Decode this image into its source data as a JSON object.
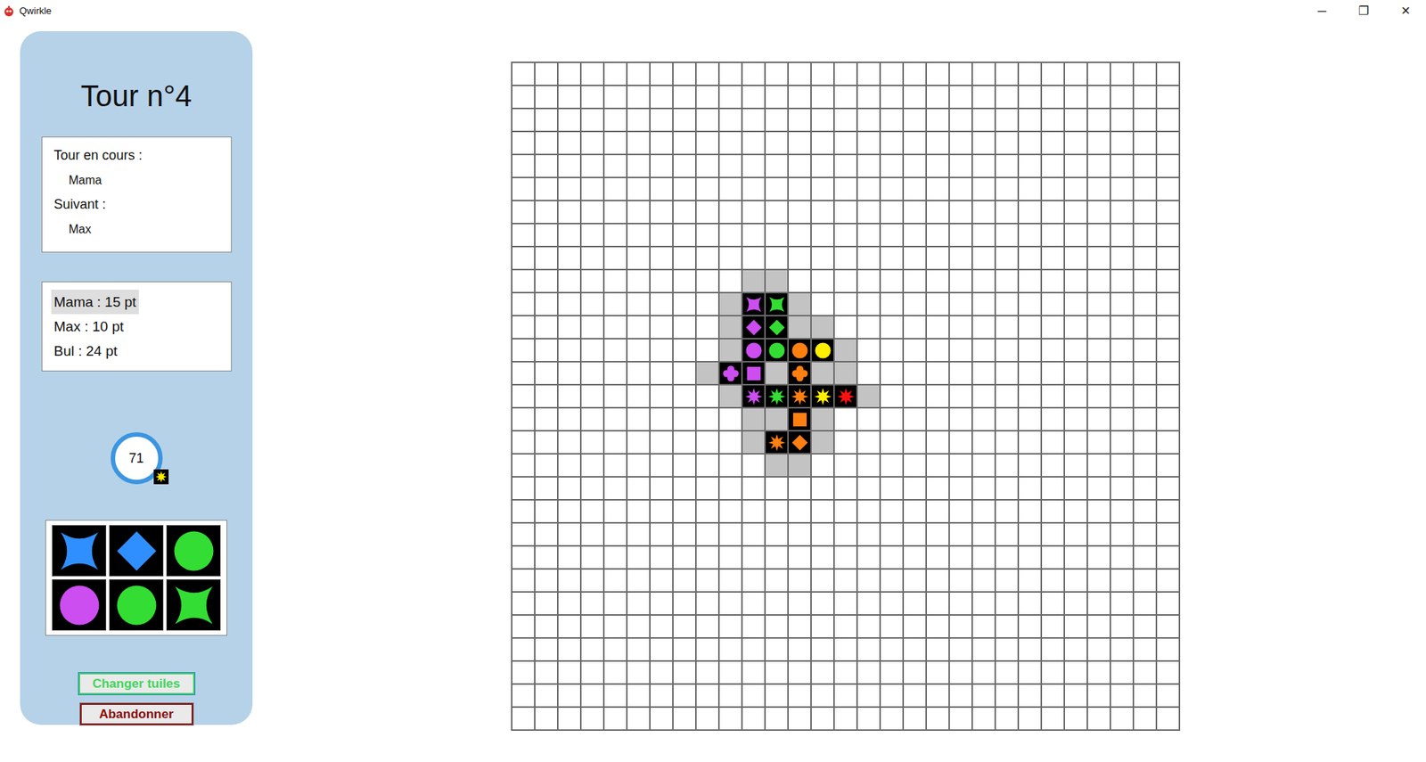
{
  "window": {
    "title": "Qwirkle",
    "controls": [
      "─",
      "❐",
      "✕"
    ]
  },
  "turn": {
    "title": "Tour n°4"
  },
  "current": {
    "label": "Tour en cours :",
    "player": "Mama",
    "next_label": "Suivant :",
    "next_player": "Max"
  },
  "scores": [
    {
      "text": "Mama : 15 pt",
      "selected": true
    },
    {
      "text": "Max : 10 pt",
      "selected": false
    },
    {
      "text": "Bul : 24 pt",
      "selected": false
    }
  ],
  "bag": {
    "count": "71"
  },
  "hand": [
    {
      "kind": "cross",
      "color": "#2f8fff"
    },
    {
      "kind": "diamond",
      "color": "#2f8fff"
    },
    {
      "kind": "circle",
      "color": "#33dd33"
    },
    {
      "kind": "circle",
      "color": "#cc4ef0"
    },
    {
      "kind": "circle",
      "color": "#33dd33"
    },
    {
      "kind": "cross",
      "color": "#33dd33"
    }
  ],
  "buttons": [
    {
      "label": "Changer tuiles",
      "kind": "exchange"
    },
    {
      "label": "Abandonner",
      "kind": "quit"
    }
  ],
  "board": {
    "size": 29,
    "tiles": [
      {
        "row": 10,
        "col": 10,
        "kind": "cross",
        "color": "#cc4ef0"
      },
      {
        "row": 10,
        "col": 11,
        "kind": "cross",
        "color": "#33dd33"
      },
      {
        "row": 11,
        "col": 10,
        "kind": "diamond",
        "color": "#cc4ef0"
      },
      {
        "row": 11,
        "col": 11,
        "kind": "diamond",
        "color": "#33dd33"
      },
      {
        "row": 12,
        "col": 10,
        "kind": "circle",
        "color": "#cc4ef0"
      },
      {
        "row": 12,
        "col": 11,
        "kind": "circle",
        "color": "#33dd33"
      },
      {
        "row": 12,
        "col": 12,
        "kind": "circle",
        "color": "#ff7f10"
      },
      {
        "row": 12,
        "col": 13,
        "kind": "circle",
        "color": "#ffee00"
      },
      {
        "row": 13,
        "col": 9,
        "kind": "clover",
        "color": "#cc4ef0"
      },
      {
        "row": 13,
        "col": 10,
        "kind": "square",
        "color": "#cc4ef0"
      },
      {
        "row": 13,
        "col": 12,
        "kind": "clover",
        "color": "#ff7f10"
      },
      {
        "row": 14,
        "col": 10,
        "kind": "starburst",
        "color": "#cc4ef0"
      },
      {
        "row": 14,
        "col": 11,
        "kind": "starburst",
        "color": "#33dd33"
      },
      {
        "row": 14,
        "col": 12,
        "kind": "starburst",
        "color": "#ff7f10"
      },
      {
        "row": 14,
        "col": 13,
        "kind": "starburst",
        "color": "#ffee00"
      },
      {
        "row": 14,
        "col": 14,
        "kind": "starburst",
        "color": "#ff1010"
      },
      {
        "row": 15,
        "col": 12,
        "kind": "square",
        "color": "#ff7f10"
      },
      {
        "row": 16,
        "col": 11,
        "kind": "starburst",
        "color": "#ff7f10"
      },
      {
        "row": 16,
        "col": 12,
        "kind": "diamond",
        "color": "#ff7f10"
      }
    ],
    "hints": [
      {
        "row": 9,
        "col": 10
      },
      {
        "row": 9,
        "col": 11
      },
      {
        "row": 10,
        "col": 9
      },
      {
        "row": 10,
        "col": 12
      },
      {
        "row": 11,
        "col": 9
      },
      {
        "row": 11,
        "col": 12
      },
      {
        "row": 11,
        "col": 13
      },
      {
        "row": 12,
        "col": 9
      },
      {
        "row": 12,
        "col": 14
      },
      {
        "row": 13,
        "col": 8
      },
      {
        "row": 13,
        "col": 11
      },
      {
        "row": 13,
        "col": 13
      },
      {
        "row": 13,
        "col": 14
      },
      {
        "row": 14,
        "col": 9
      },
      {
        "row": 14,
        "col": 15
      },
      {
        "row": 15,
        "col": 10
      },
      {
        "row": 15,
        "col": 11
      },
      {
        "row": 15,
        "col": 13
      },
      {
        "row": 16,
        "col": 10
      },
      {
        "row": 16,
        "col": 13
      },
      {
        "row": 17,
        "col": 11
      },
      {
        "row": 17,
        "col": 12
      }
    ]
  }
}
